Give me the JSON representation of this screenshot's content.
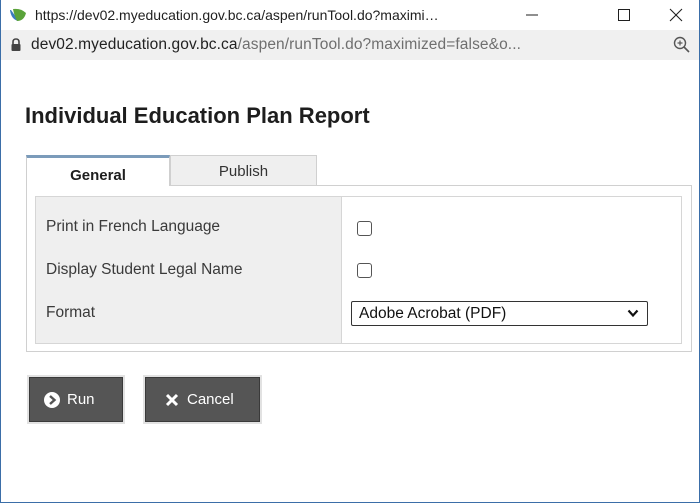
{
  "window": {
    "title": "https://dev02.myeducation.gov.bc.ca/aspen/runTool.do?maximi…",
    "controls": {
      "minimize": "—",
      "maximize": "☐",
      "close": "✕"
    }
  },
  "address_bar": {
    "host": "dev02.myeducation.gov.bc.ca",
    "path": "/aspen/runTool.do?maximized=false&o..."
  },
  "page": {
    "title": "Individual Education Plan Report"
  },
  "tabs": [
    {
      "label": "General",
      "active": true
    },
    {
      "label": "Publish",
      "active": false
    }
  ],
  "form": {
    "rows": [
      {
        "label": "Print in French Language",
        "type": "checkbox",
        "checked": false
      },
      {
        "label": "Display Student Legal Name",
        "type": "checkbox",
        "checked": false
      },
      {
        "label": "Format",
        "type": "select",
        "value": "Adobe Acrobat (PDF)"
      }
    ]
  },
  "buttons": {
    "run": "Run",
    "cancel": "Cancel"
  },
  "icons": {
    "favicon": "bc-leaf-icon",
    "lock": "lock-icon",
    "zoom": "zoom-icon",
    "run": "arrow-right-circle-icon",
    "cancel": "x-icon",
    "select": "chevron-down-icon"
  },
  "colors": {
    "tab_accent": "#7b9bba",
    "button_bg": "#555555",
    "label_column_bg": "#efefef"
  }
}
